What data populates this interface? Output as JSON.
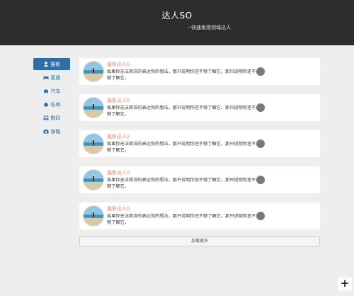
{
  "header": {
    "title": "达人SO",
    "subtitle": "--快速发现领域达人"
  },
  "sidebar": {
    "items": [
      {
        "label": "摄影",
        "icon": "user-icon",
        "active": true
      },
      {
        "label": "家居",
        "icon": "sofa-icon",
        "active": false
      },
      {
        "label": "汽车",
        "icon": "car-icon",
        "active": false
      },
      {
        "label": "吃喝",
        "icon": "home-icon",
        "active": false
      },
      {
        "label": "数码",
        "icon": "laptop-icon",
        "active": false
      },
      {
        "label": "穿戴",
        "icon": "camera-icon",
        "active": false
      }
    ]
  },
  "feed": {
    "items": [
      {
        "name": "摄影达人0",
        "description": "如果你无法简洁的表达你的想法，那只说明你还不够了解它。那只说明你还不够了解它。"
      },
      {
        "name": "摄影达人5",
        "description": "如果你无法简洁的表达你的想法，那只说明你还不够了解它。那只说明你还不够了解它。"
      },
      {
        "name": "摄影达人2",
        "description": "如果你无法简洁的表达你的想法，那只说明你还不够了解它。那只说明你还不够了解它。"
      },
      {
        "name": "摄影达人0",
        "description": "如果你无法简洁的表达你的想法，那只说明你还不够了解它。那只说明你还不够了解它。"
      },
      {
        "name": "摄影达人0",
        "description": "如果你无法简洁的表达你的想法，那只说明你还不够了解它。那只说明你还不够了解它。"
      }
    ]
  },
  "load_more": {
    "label": "加载更多"
  },
  "fab": {
    "label": "+"
  },
  "colors": {
    "header_bg": "#2d2d2d",
    "accent": "#2f6da6",
    "name_color": "#e08a7a"
  }
}
